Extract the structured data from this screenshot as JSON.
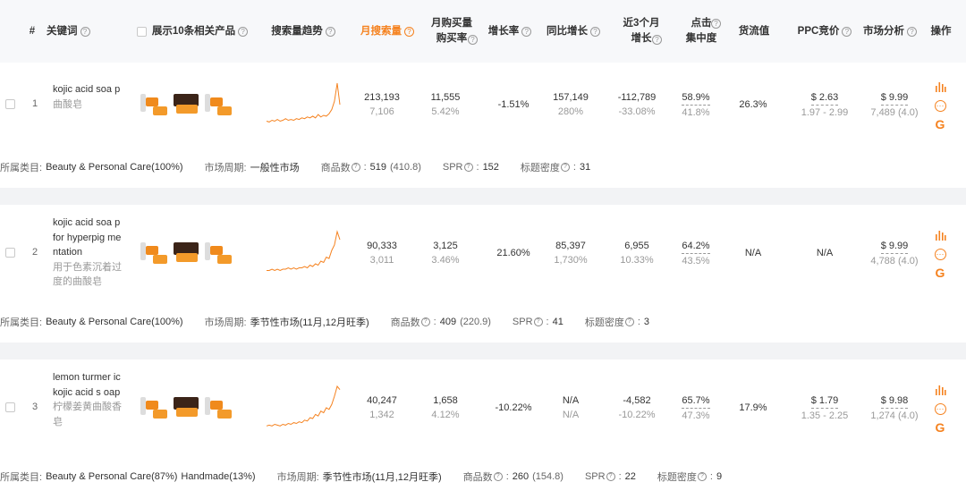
{
  "header": {
    "cols": [
      {
        "key": "idx",
        "label": "#"
      },
      {
        "key": "keyword",
        "label": "关键词"
      },
      {
        "key": "products",
        "label": "展示10条相关产品"
      },
      {
        "key": "trend",
        "label": "搜索量趋势"
      },
      {
        "key": "monthly_search",
        "label": "月搜索量"
      },
      {
        "key": "buy_rate",
        "label": "月购买量\n购买率"
      },
      {
        "key": "growth",
        "label": "增长率"
      },
      {
        "key": "yoy",
        "label": "同比增长"
      },
      {
        "key": "three_month",
        "label": "近3个月\n增长"
      },
      {
        "key": "click",
        "label": "点击\n集中度"
      },
      {
        "key": "gmv",
        "label": "货流值"
      },
      {
        "key": "ppc",
        "label": "PPC竞价"
      },
      {
        "key": "market",
        "label": "市场分析"
      },
      {
        "key": "ops",
        "label": "操作"
      }
    ]
  },
  "rows": [
    {
      "index": "1",
      "keyword_en": "kojic acid soa p",
      "keyword_cn": "曲酸皂",
      "trend": [
        6,
        5,
        7,
        6,
        8,
        6,
        7,
        9,
        7,
        8,
        7,
        9,
        8,
        10,
        9,
        11,
        10,
        12,
        10,
        14,
        11,
        13,
        12,
        15,
        20,
        30,
        52,
        26
      ],
      "search_volume": "213,193",
      "search_sub": "7,106",
      "purchases": "11,555",
      "purchase_rate": "5.42%",
      "growth": "-1.51%",
      "yoy": "157,149",
      "yoy_pct": "280%",
      "three_month": "-112,789",
      "three_month_pct": "-33.08%",
      "click": "58.9%",
      "click_sub": "41.8%",
      "gmv": "26.3%",
      "ppc": "$ 2.63",
      "ppc_range": "1.97 - 2.99",
      "market_price": "$ 9.99",
      "market_sub": "7,489 (4.0)",
      "meta": {
        "category_label": "所属类目:",
        "category": "Beauty & Personal Care(100%)",
        "category2": "",
        "cycle_label": "市场周期:",
        "cycle": "一般性市场",
        "products_label": "商品数",
        "products": "519",
        "products_sub": "(410.8)",
        "spr_label": "SPR",
        "spr": "152",
        "density_label": "标题密度",
        "density": "31"
      }
    },
    {
      "index": "2",
      "keyword_en": "kojic acid soa p for hyperpig mentation",
      "keyword_cn": "用于色素沉着过度的曲酸皂",
      "trend": [
        3,
        3,
        4,
        3,
        4,
        3,
        4,
        4,
        5,
        4,
        5,
        4,
        5,
        5,
        6,
        5,
        7,
        6,
        8,
        7,
        10,
        9,
        13,
        12,
        18,
        22,
        32,
        26
      ],
      "search_volume": "90,333",
      "search_sub": "3,011",
      "purchases": "3,125",
      "purchase_rate": "3.46%",
      "growth": "21.60%",
      "yoy": "85,397",
      "yoy_pct": "1,730%",
      "three_month": "6,955",
      "three_month_pct": "10.33%",
      "click": "64.2%",
      "click_sub": "43.5%",
      "gmv": "N/A",
      "ppc": "N/A",
      "ppc_range": "",
      "market_price": "$ 9.99",
      "market_sub": "4,788 (4.0)",
      "meta": {
        "category_label": "所属类目:",
        "category": "Beauty & Personal Care(100%)",
        "category2": "",
        "cycle_label": "市场周期:",
        "cycle": "季节性市场(11月,12月旺季)",
        "products_label": "商品数",
        "products": "409",
        "products_sub": "(220.9)",
        "spr_label": "SPR",
        "spr": "41",
        "density_label": "标题密度",
        "density": "3"
      }
    },
    {
      "index": "3",
      "keyword_en": "lemon turmer ic kojic acid s oap",
      "keyword_cn": "柠檬姜黄曲酸香皂",
      "trend": [
        4,
        5,
        4,
        6,
        5,
        4,
        6,
        5,
        7,
        6,
        8,
        7,
        9,
        8,
        11,
        10,
        14,
        13,
        18,
        16,
        22,
        20,
        26,
        24,
        30,
        40,
        52,
        48
      ],
      "search_volume": "40,247",
      "search_sub": "1,342",
      "purchases": "1,658",
      "purchase_rate": "4.12%",
      "growth": "-10.22%",
      "yoy": "N/A",
      "yoy_pct": "N/A",
      "three_month": "-4,582",
      "three_month_pct": "-10.22%",
      "click": "65.7%",
      "click_sub": "47.3%",
      "gmv": "17.9%",
      "ppc": "$ 1.79",
      "ppc_range": "1.35 - 2.25",
      "market_price": "$ 9.98",
      "market_sub": "1,274 (4.0)",
      "meta": {
        "category_label": "所属类目:",
        "category": "Beauty & Personal Care(87%)",
        "category2": "Handmade(13%)",
        "cycle_label": "市场周期:",
        "cycle": "季节性市场(11月,12月旺季)",
        "products_label": "商品数",
        "products": "260",
        "products_sub": "(154.8)",
        "spr_label": "SPR",
        "spr": "22",
        "density_label": "标题密度",
        "density": "9"
      }
    }
  ],
  "icons": {
    "chart": "bar-chart-icon",
    "more": "more-dots-icon",
    "google": "google-icon"
  },
  "colors": {
    "accent": "#f5821f",
    "trend_line": "#f5821f",
    "header_bg": "#f7f8fa",
    "separator": "#f2f3f5"
  }
}
